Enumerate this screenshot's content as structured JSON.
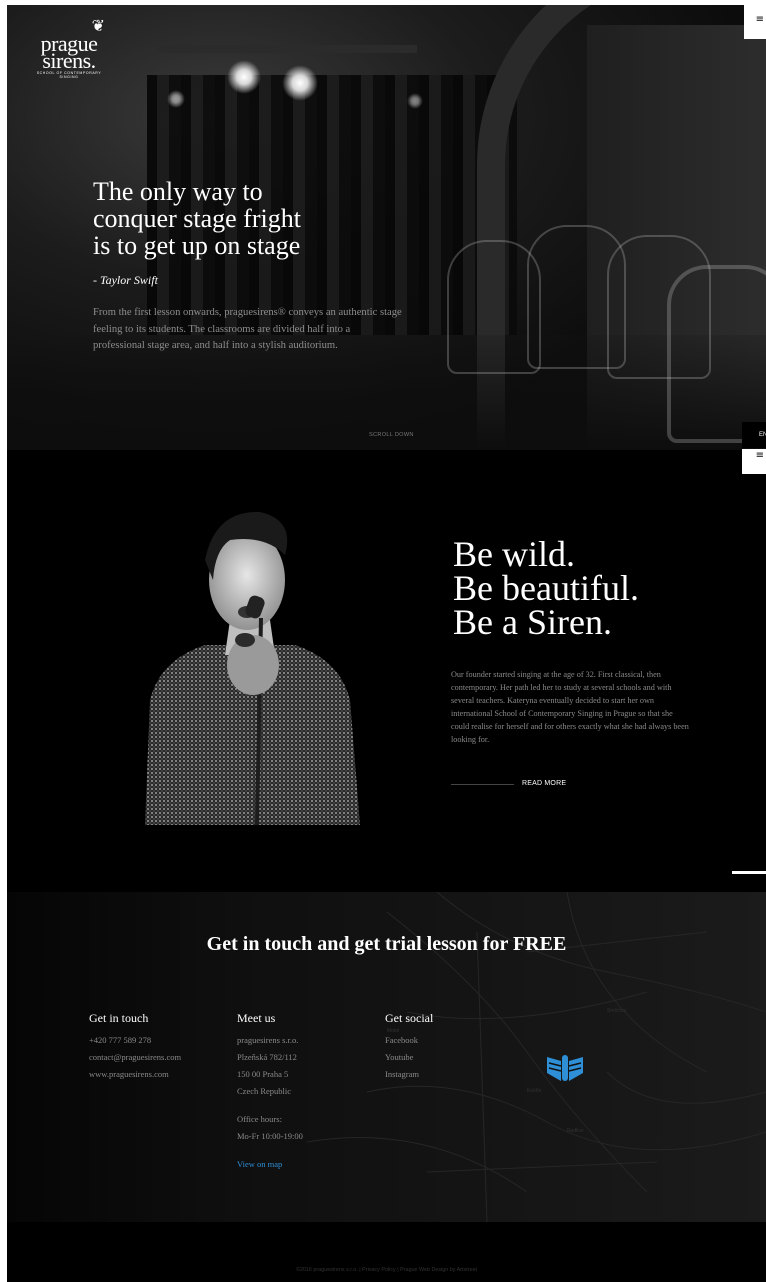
{
  "brand": {
    "logo_word": "prague sirens.",
    "logo_word_line1": "prague",
    "logo_word_line2": "sirens.",
    "logo_tagline": "SCHOOL OF CONTEMPORARY SINGING"
  },
  "nav": {
    "menu_icon": "hamburger-icon",
    "language": "EN"
  },
  "hero": {
    "quote_line1": "The only way to",
    "quote_line2": "conquer stage fright",
    "quote_line3": "is to get up on stage",
    "author": "- Taylor Swift",
    "text": "From the first lesson onwards, praguesirens® conveys an authentic stage feeling to its students. The classrooms are divided half into a professional stage area, and half into a stylish auditorium.",
    "scroll_down": "SCROLL DOWN"
  },
  "siren": {
    "title_line1": "Be wild.",
    "title_line2": "Be beautiful.",
    "title_line3": "Be a Siren.",
    "text": "Our founder started singing at the age of 32. First classical, then contemporary. Her path led her to study at several schools and with several teachers. Kateryna eventually decided to start her own international School of Contemporary Singing in Prague so that she could realise for herself and for others exactly what she had always been looking for.",
    "read_more": "READ MORE"
  },
  "contact": {
    "title": "Get in touch and get trial lesson for FREE",
    "get_in_touch": {
      "heading": "Get in touch",
      "phone": "+420 777 589 278",
      "email": "contact@praguesirens.com",
      "web": "www.praguesirens.com"
    },
    "meet_us": {
      "heading": "Meet us",
      "company": "praguesirens s.r.o.",
      "street": "Plzeňská 782/112",
      "city": "150 00 Praha 5",
      "country": "Czech Republic",
      "office_label": "Office hours:",
      "office_hours": "Mo-Fr 10:00-19:00",
      "map_link": "View on map"
    },
    "get_social": {
      "heading": "Get social",
      "items": [
        "Facebook",
        "Youtube",
        "Instagram"
      ]
    },
    "map_labels": [
      "Smíchov",
      "Košíře",
      "Motol",
      "Radlice"
    ]
  },
  "footer": {
    "text": "©2016 praguesirens s.r.o. | Privacy Policy | Prague Web Design by Artstreet"
  },
  "colors": {
    "accent_blue": "#2e8fd6",
    "background": "#000000"
  }
}
